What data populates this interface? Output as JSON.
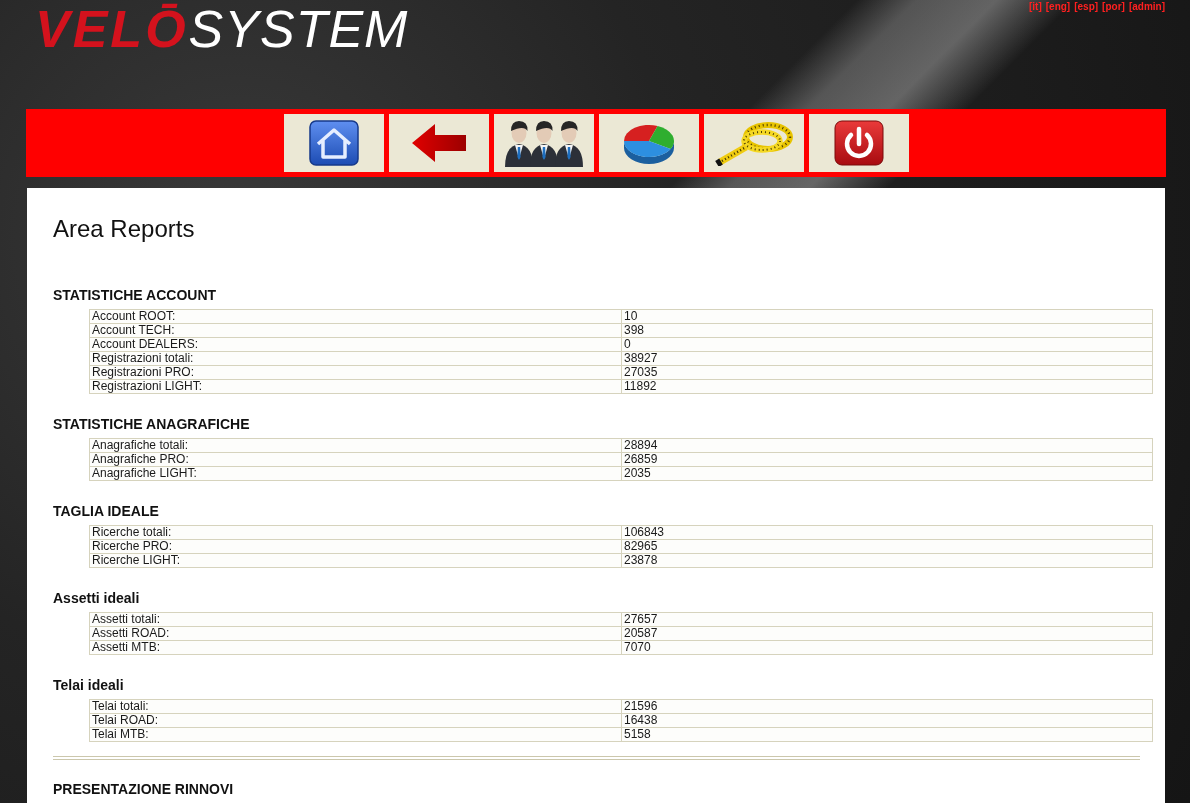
{
  "header": {
    "logo": {
      "accent": "VELŌ",
      "text": "SYSTEM"
    },
    "links": [
      "[it]",
      "[eng]",
      "[esp]",
      "[por]",
      "[admin]"
    ]
  },
  "nav": [
    {
      "kind": "home"
    },
    {
      "kind": "back"
    },
    {
      "kind": "users"
    },
    {
      "kind": "chart"
    },
    {
      "kind": "measure"
    },
    {
      "kind": "power"
    }
  ],
  "content": {
    "title": "Area Reports",
    "sections": [
      {
        "title": "STATISTICHE ACCOUNT",
        "rows": [
          {
            "label": "Account ROOT:",
            "value": "10"
          },
          {
            "label": "Account TECH:",
            "value": "398"
          },
          {
            "label": "Account DEALERS:",
            "value": "0"
          },
          {
            "label": "Registrazioni totali:",
            "value": "38927"
          },
          {
            "label": "Registrazioni PRO:",
            "value": "27035"
          },
          {
            "label": "Registrazioni LIGHT:",
            "value": "11892"
          }
        ]
      },
      {
        "title": "STATISTICHE ANAGRAFICHE",
        "rows": [
          {
            "label": "Anagrafiche totali:",
            "value": "28894"
          },
          {
            "label": "Anagrafiche PRO:",
            "value": "26859"
          },
          {
            "label": "Anagrafiche LIGHT:",
            "value": "2035"
          }
        ]
      },
      {
        "title": "TAGLIA IDEALE",
        "rows": [
          {
            "label": "Ricerche totali:",
            "value": "106843"
          },
          {
            "label": "Ricerche PRO:",
            "value": "82965"
          },
          {
            "label": "Ricerche LIGHT:",
            "value": "23878"
          }
        ]
      },
      {
        "title": "Assetti ideali",
        "rows": [
          {
            "label": "Assetti totali:",
            "value": "27657"
          },
          {
            "label": "Assetti ROAD:",
            "value": "20587"
          },
          {
            "label": "Assetti MTB:",
            "value": "7070"
          }
        ]
      },
      {
        "title": "Telai ideali",
        "rows": [
          {
            "label": "Telai totali:",
            "value": "21596"
          },
          {
            "label": "Telai ROAD:",
            "value": "16438"
          },
          {
            "label": "Telai MTB:",
            "value": "5158"
          }
        ]
      }
    ],
    "next_section": {
      "title": "PRESENTAZIONE RINNOVI"
    }
  }
}
